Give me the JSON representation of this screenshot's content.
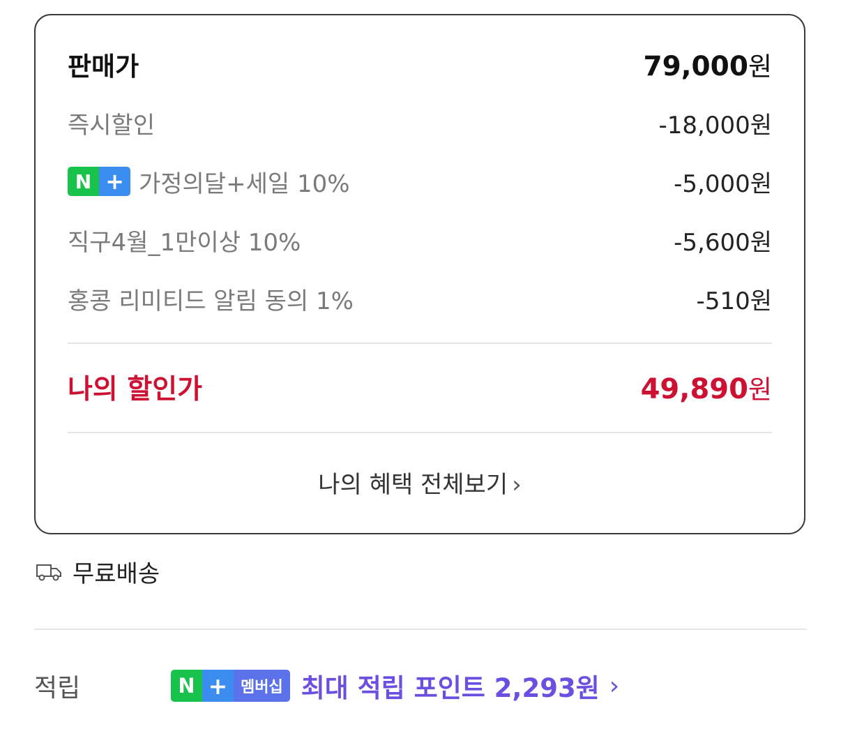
{
  "price_box": {
    "sale_price": {
      "label": "판매가",
      "amount": "79,000",
      "unit": "원"
    },
    "discounts": [
      {
        "label": "즉시할인",
        "value": "-18,000원",
        "badge": false
      },
      {
        "label": "가정의달+세일 10%",
        "value": "-5,000원",
        "badge": true
      },
      {
        "label": "직구4월_1만이상 10%",
        "value": "-5,600원",
        "badge": false
      },
      {
        "label": "홍콩 리미티드 알림 동의 1%",
        "value": "-510원",
        "badge": false
      }
    ],
    "final_price": {
      "label": "나의 할인가",
      "amount": "49,890",
      "unit": "원"
    },
    "view_all_label": "나의 혜택 전체보기",
    "view_all_chevron": "›"
  },
  "nplus_badge": {
    "n": "N",
    "plus": "+",
    "membership": "멤버십"
  },
  "shipping": {
    "icon": "truck-icon",
    "label": "무료배송"
  },
  "reward": {
    "label": "적립",
    "link_text": "최대 적립 포인트 2,293원",
    "chevron": "›"
  },
  "colors": {
    "discount_red": "#cc1133",
    "reward_purple": "#6b4fe0",
    "nplus_green": "#19c24a",
    "nplus_blue": "#3b8df0",
    "membership_blue": "#5b72ea"
  }
}
